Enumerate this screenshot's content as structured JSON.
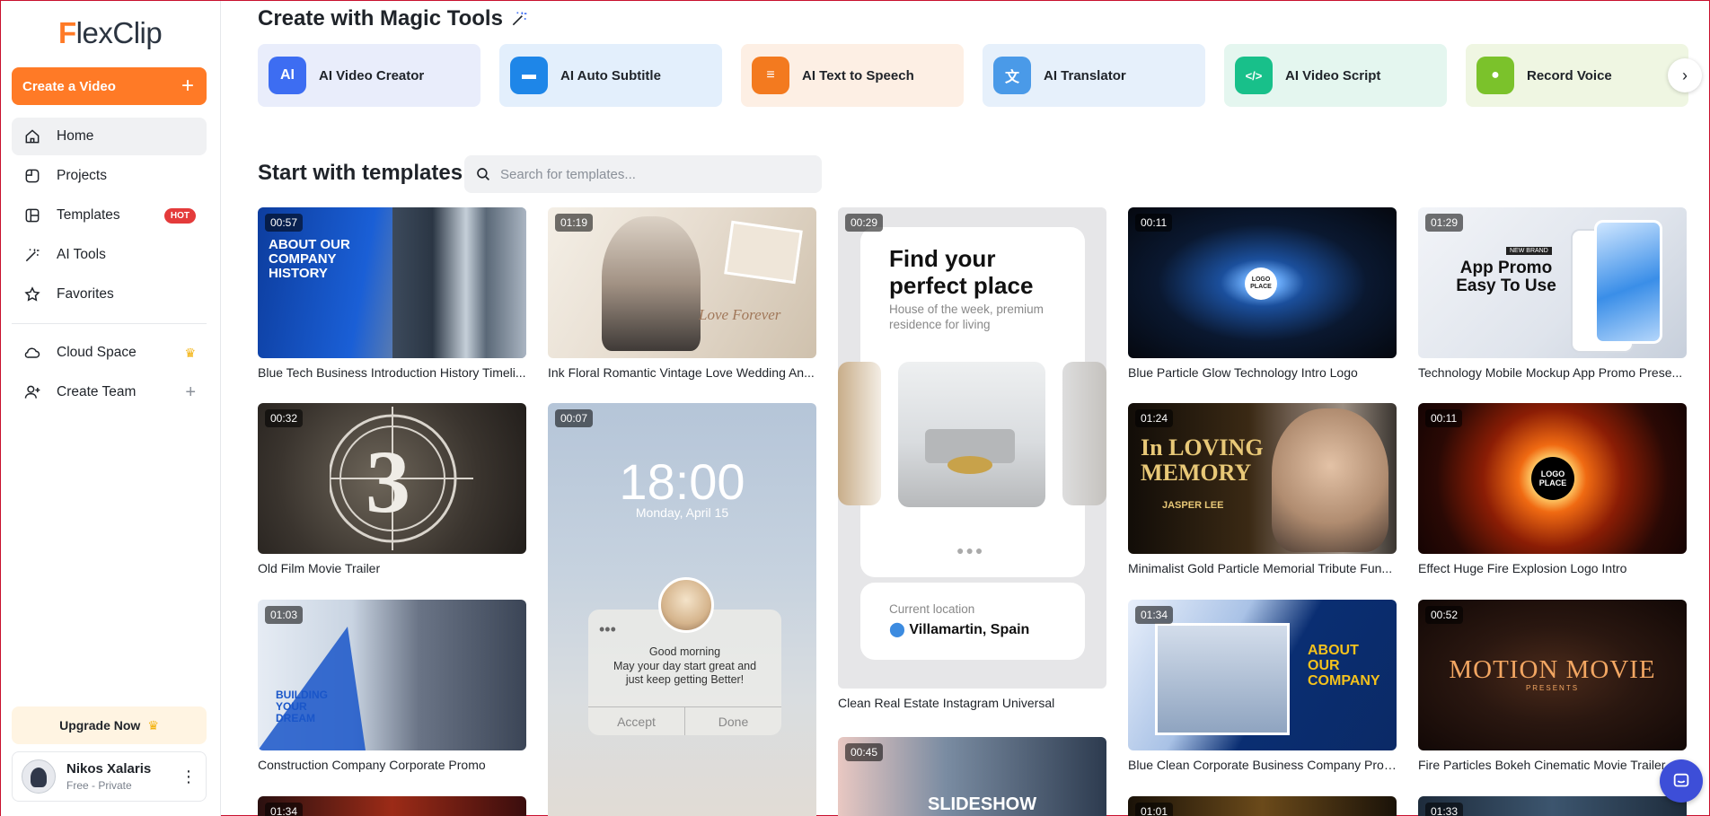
{
  "sidebar": {
    "logo": {
      "mark": "F",
      "text": "lexClip"
    },
    "create_label": "Create a Video",
    "create_plus": "+",
    "nav": [
      {
        "label": "Home"
      },
      {
        "label": "Projects"
      },
      {
        "label": "Templates",
        "badge": "HOT"
      },
      {
        "label": "AI Tools"
      },
      {
        "label": "Favorites"
      }
    ],
    "nav2": [
      {
        "label": "Cloud Space"
      },
      {
        "label": "Create Team"
      }
    ],
    "upgrade_label": "Upgrade Now",
    "user": {
      "name": "Nikos Xalaris",
      "plan": "Free - Private"
    }
  },
  "magic": {
    "title": "Create with Magic Tools",
    "tools": [
      {
        "label": "AI Video Creator",
        "bg": "#e9edfb",
        "icon_bg": "#3d6df2",
        "glyph": "AI"
      },
      {
        "label": "AI Auto Subtitle",
        "bg": "#e3effc",
        "icon_bg": "#1e86e8",
        "glyph": "▬"
      },
      {
        "label": "AI Text to Speech",
        "bg": "#fdefe4",
        "icon_bg": "#f37a1f",
        "glyph": "≡"
      },
      {
        "label": "AI Translator",
        "bg": "#e6f0fb",
        "icon_bg": "#4a9ae8",
        "glyph": "文"
      },
      {
        "label": "AI Video Script",
        "bg": "#e4f6ef",
        "icon_bg": "#18c08a",
        "glyph": "</>"
      },
      {
        "label": "Record Voice",
        "bg": "#eff6e2",
        "icon_bg": "#7bc22b",
        "glyph": "●"
      }
    ]
  },
  "templates": {
    "title": "Start with templates",
    "search_placeholder": "Search for templates...",
    "items": [
      {
        "duration": "00:57",
        "caption": "Blue Tech Business Introduction History Timeli...",
        "overlay": "ABOUT OUR COMPANY HISTORY"
      },
      {
        "duration": "01:19",
        "caption": "Ink Floral Romantic Vintage Love Wedding An...",
        "overlay": "Love Forever"
      },
      {
        "duration": "00:29",
        "caption": "Clean Real Estate Instagram Universal",
        "overlay_title": "Find your perfect place",
        "overlay_sub": "House of the week, premium residence for living",
        "location_label": "Current location",
        "location": "Villamartin, Spain"
      },
      {
        "duration": "00:11",
        "caption": "Blue Particle Glow Technology Intro Logo",
        "overlay": "LOGO PLACE"
      },
      {
        "duration": "01:29",
        "caption": "Technology Mobile Mockup App Promo Prese...",
        "overlay": "App Promo Easy To Use",
        "badge": "NEW BRAND"
      },
      {
        "duration": "00:32",
        "caption": "Old Film Movie Trailer",
        "overlay": "3"
      },
      {
        "duration": "00:07",
        "caption": "",
        "time": "18:00",
        "date": "Monday, April 15",
        "greeting": "Good morning",
        "message": "May your day start great and just keep getting Better!",
        "accept": "Accept",
        "done": "Done"
      },
      {
        "duration": "01:24",
        "caption": "Minimalist Gold Particle Memorial Tribute Fun...",
        "overlay": "In LOVING MEMORY",
        "name": "JASPER LEE"
      },
      {
        "duration": "00:11",
        "caption": "Effect Huge Fire Explosion Logo Intro",
        "overlay": "LOGO PLACE"
      },
      {
        "duration": "01:03",
        "caption": "Construction Company Corporate Promo",
        "overlay": "BUILDING YOUR DREAM"
      },
      {
        "duration": "01:34",
        "caption": "Blue Clean Corporate Business Company Profi...",
        "overlay": "ABOUT OUR COMPANY"
      },
      {
        "duration": "00:52",
        "caption": "Fire Particles Bokeh Cinematic Movie Trailer",
        "overlay": "MOTION MOVIE",
        "sub": "PRESENTS"
      },
      {
        "duration": "00:45",
        "caption": "",
        "overlay": "SLIDESHOW"
      },
      {
        "duration": "01:34",
        "caption": ""
      },
      {
        "duration": "01:01",
        "caption": ""
      },
      {
        "duration": "01:33",
        "caption": ""
      }
    ]
  }
}
